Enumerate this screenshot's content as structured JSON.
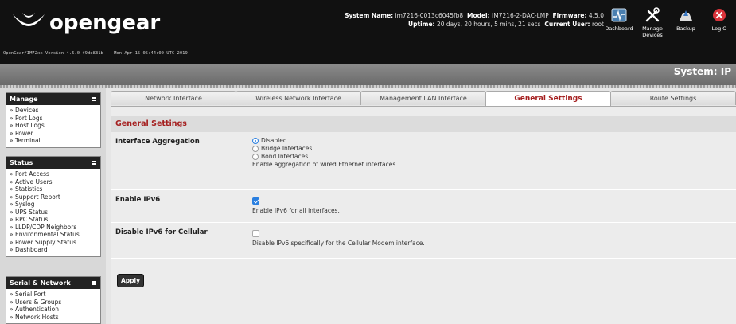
{
  "header": {
    "logo_text": "opengear",
    "version_line": "OpenGear/IM72xx Version 4.5.0 f9de831b -- Mon Apr 15 05:44:00 UTC 2019",
    "system_name_label": "System Name:",
    "system_name": "im7216-0013c6045fb8",
    "model_label": "Model:",
    "model": "IM7216-2-DAC-LMP",
    "firmware_label": "Firmware:",
    "firmware": "4.5.0",
    "uptime_label": "Uptime:",
    "uptime": "20 days, 20 hours, 5 mins, 21 secs",
    "user_label": "Current User:",
    "user": "root",
    "actions": [
      {
        "label": "Dashboard",
        "icon": "dashboard-icon"
      },
      {
        "label": "Manage Devices",
        "icon": "tools-icon"
      },
      {
        "label": "Backup",
        "icon": "backup-icon"
      },
      {
        "label": "Log O",
        "icon": "logout-icon"
      }
    ]
  },
  "page_title": "System: IP",
  "sidebar": {
    "manage": {
      "title": "Manage",
      "items": [
        "» Devices",
        "» Port Logs",
        "» Host Logs",
        "» Power",
        "» Terminal"
      ]
    },
    "status": {
      "title": "Status",
      "items": [
        "» Port Access",
        "» Active Users",
        "» Statistics",
        "» Support Report",
        "» Syslog",
        "» UPS Status",
        "» RPC Status",
        "» LLDP/CDP Neighbors",
        "» Environmental Status",
        "» Power Supply Status",
        "» Dashboard"
      ]
    },
    "serial": {
      "title": "Serial & Network",
      "items": [
        "» Serial Port",
        "» Users & Groups",
        "» Authentication",
        "» Network Hosts"
      ]
    }
  },
  "tabs": [
    "Network Interface",
    "Wireless Network Interface",
    "Management LAN Interface",
    "General Settings",
    "Route Settings"
  ],
  "section_title": "General Settings",
  "aggregation": {
    "label": "Interface Aggregation",
    "options": [
      "Disabled",
      "Bridge Interfaces",
      "Bond Interfaces"
    ],
    "selected": "Disabled",
    "help": "Enable aggregation of wired Ethernet interfaces."
  },
  "ipv6": {
    "label": "Enable IPv6",
    "checked": true,
    "help": "Enable IPv6 for all interfaces."
  },
  "ipv6_cell": {
    "label": "Disable IPv6 for Cellular",
    "checked": false,
    "help": "Disable IPv6 specifically for the Cellular Modem interface."
  },
  "apply_label": "Apply",
  "colors": {
    "accent": "#a52020",
    "header_bg": "#111111",
    "checkbox": "#2a7fe0"
  }
}
